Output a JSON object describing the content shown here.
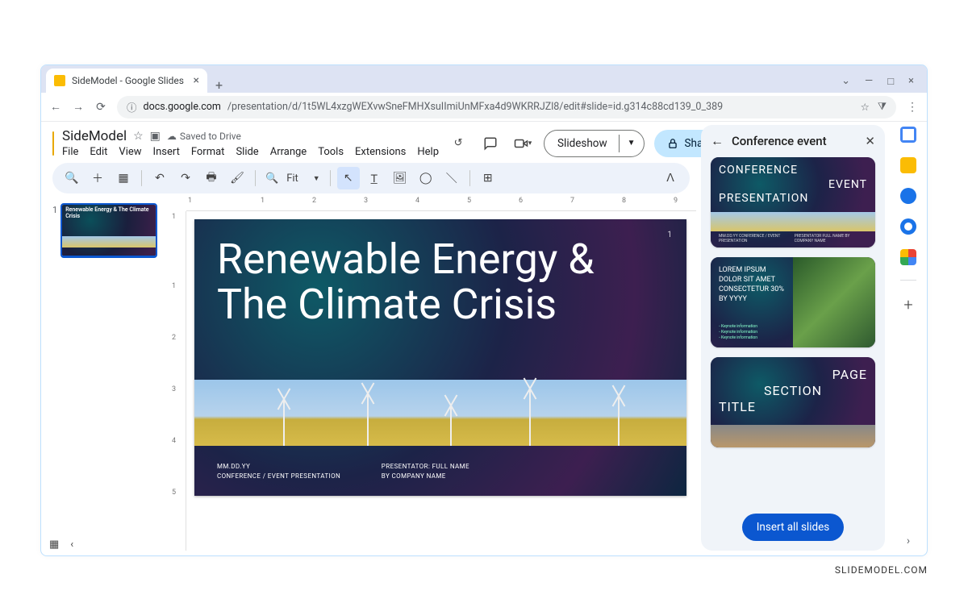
{
  "browser": {
    "tab_title": "SideModel - Google Slides",
    "url_host": "docs.google.com",
    "url_path": "/presentation/d/1t5WL4xzgWEXvwSneFMHXsuIImiUnMFxa4d9WKRRJZl8/edit#slide=id.g314c88cd139_0_389"
  },
  "app": {
    "doc_title": "SideModel",
    "save_status": "Saved to Drive",
    "menus": [
      "File",
      "Edit",
      "View",
      "Insert",
      "Format",
      "Slide",
      "Arrange",
      "Tools",
      "Extensions",
      "Help"
    ],
    "slideshow_label": "Slideshow",
    "share_label": "Share",
    "zoom_label": "Fit"
  },
  "ruler": {
    "h": [
      "1",
      "",
      "1",
      "2",
      "3",
      "4",
      "5",
      "6",
      "7",
      "8",
      "9"
    ],
    "v": [
      "1",
      "",
      "1",
      "2",
      "3",
      "4",
      "5"
    ]
  },
  "filmstrip": {
    "slides": [
      {
        "number": "1",
        "title_lines": "Renewable Energy & The Climate Crisis"
      }
    ]
  },
  "slide": {
    "number": "1",
    "title": "Renewable Energy & The Climate Crisis",
    "meta_date": "MM.DD.YY",
    "meta_event": "CONFERENCE / EVENT PRESENTATION",
    "meta_presenter": "PRESENTATOR: FULL NAME",
    "meta_company": "BY COMPANY NAME"
  },
  "panel": {
    "title": "Conference event",
    "insert_label": "Insert all slides",
    "templates": {
      "t1_l1": "CONFERENCE",
      "t1_l2": "EVENT",
      "t1_l3": "PRESENTATION",
      "t1_foot_left": "MM.DD.YY  CONFERENCE / EVENT PRESENTATION",
      "t1_foot_right": "PRESENTATOR  FULL NAME  BY COMPANY NAME",
      "t2_text": "LOREM IPSUM DOLOR SIT AMET CONSECTETUR 30% BY YYYY",
      "t2_b1": "Keynote information",
      "t2_b2": "Keynote information",
      "t2_b3": "Keynote information",
      "t3_l1": "PAGE",
      "t3_l2": "SECTION",
      "t3_l3": "TITLE"
    }
  },
  "attribution": "SLIDEMODEL.COM"
}
